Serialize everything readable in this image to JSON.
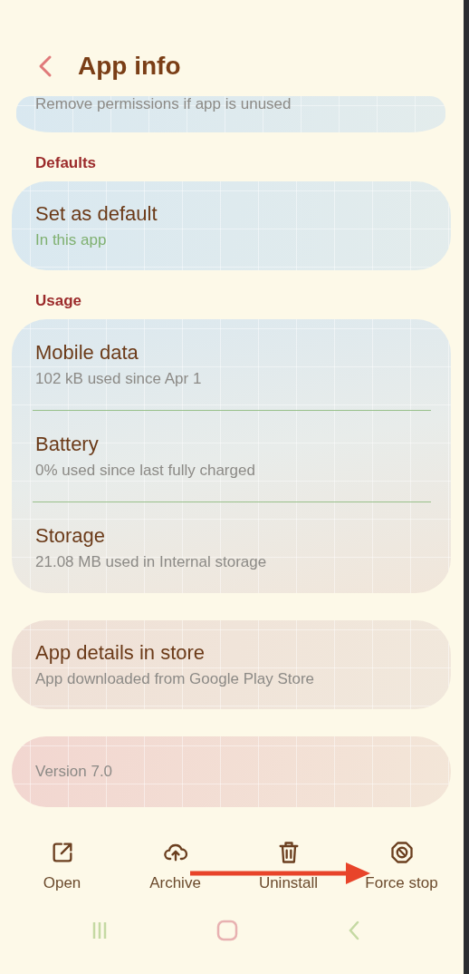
{
  "header": {
    "title": "App info"
  },
  "partial_card": {
    "subtitle": "Remove permissions if app is unused"
  },
  "sections": [
    {
      "heading": "Defaults",
      "items": [
        {
          "title": "Set as default",
          "subtitle": "In this app",
          "accent": true
        }
      ]
    },
    {
      "heading": "Usage",
      "items": [
        {
          "title": "Mobile data",
          "subtitle": "102 kB used since Apr 1",
          "accent": false
        },
        {
          "title": "Battery",
          "subtitle": "0% used since last fully charged",
          "accent": false
        },
        {
          "title": "Storage",
          "subtitle": "21.08 MB used in Internal storage",
          "accent": false
        }
      ]
    },
    {
      "items": [
        {
          "title": "App details in store",
          "subtitle": "App downloaded from Google Play Store",
          "accent": false
        }
      ]
    },
    {
      "items": [
        {
          "subtitle": "Version 7.0",
          "accent": false
        }
      ]
    }
  ],
  "actions": [
    {
      "label": "Open",
      "kind": "open"
    },
    {
      "label": "Archive",
      "kind": "archive"
    },
    {
      "label": "Uninstall",
      "kind": "uninstall"
    },
    {
      "label": "Force stop",
      "kind": "stop"
    }
  ]
}
